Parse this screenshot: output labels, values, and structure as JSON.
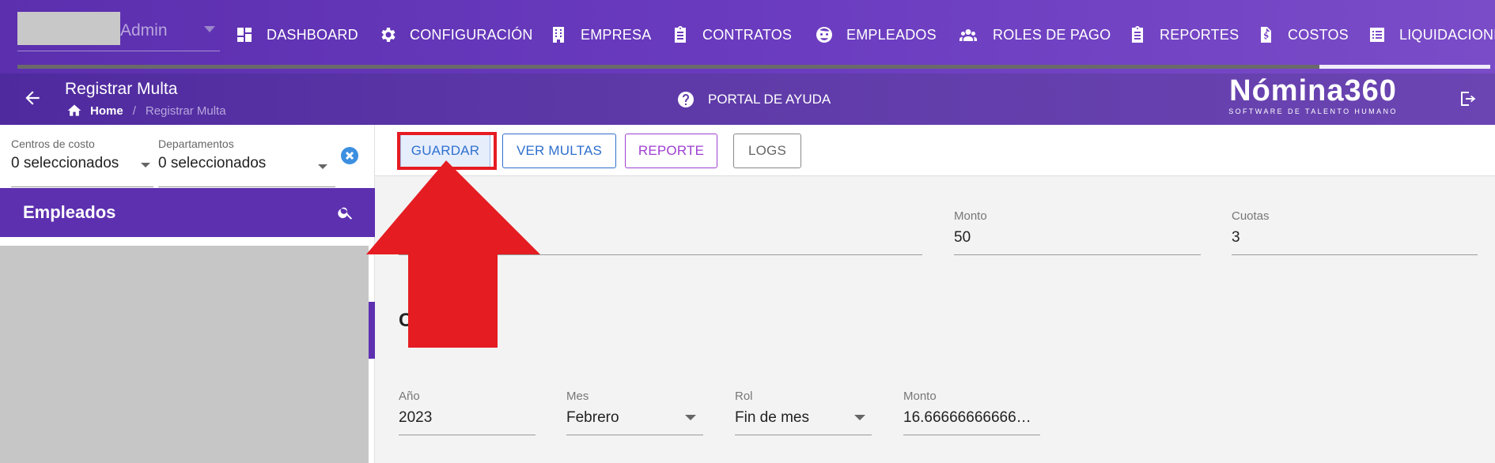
{
  "user": {
    "name": "Admin"
  },
  "nav": {
    "items": [
      {
        "label": "DASHBOARD",
        "icon": "dashboard-icon"
      },
      {
        "label": "CONFIGURACIÓN",
        "icon": "gear-icon"
      },
      {
        "label": "EMPRESA",
        "icon": "building-icon"
      },
      {
        "label": "CONTRATOS",
        "icon": "clipboard-icon"
      },
      {
        "label": "EMPLEADOS",
        "icon": "face-icon"
      },
      {
        "label": "ROLES DE PAGO",
        "icon": "people-icon"
      },
      {
        "label": "REPORTES",
        "icon": "clipboard-list-icon"
      },
      {
        "label": "COSTOS",
        "icon": "invoice-icon"
      },
      {
        "label": "LIQUIDACIONE",
        "icon": "list-icon"
      }
    ]
  },
  "header": {
    "title": "Registrar Multa",
    "breadcrumb": {
      "home": "Home",
      "separator": "/",
      "current": "Registrar Multa"
    },
    "help_label": "PORTAL DE AYUDA",
    "brand_name": "Nómina360",
    "brand_tagline": "SOFTWARE DE TALENTO HUMANO"
  },
  "filters": {
    "centros": {
      "label": "Centros de costo",
      "value": "0 seleccionados"
    },
    "departamentos": {
      "label": "Departamentos",
      "value": "0 seleccionados"
    }
  },
  "employees": {
    "title": "Empleados"
  },
  "toolbar": {
    "guardar": "GUARDAR",
    "ver_multas": "VER MULTAS",
    "reporte": "REPORTE",
    "logs": "LOGS"
  },
  "form": {
    "monto": {
      "label": "Monto",
      "value": "50"
    },
    "cuotas": {
      "label": "Cuotas",
      "value": "3"
    },
    "section_title": "C",
    "anio": {
      "label": "Año",
      "value": "2023"
    },
    "mes": {
      "label": "Mes",
      "value": "Febrero"
    },
    "rol": {
      "label": "Rol",
      "value": "Fin de mes"
    },
    "monto_cuota": {
      "label": "Monto",
      "value": "16.66666666666…"
    }
  },
  "colors": {
    "nav_bg": "#6a3bbf",
    "panel_accent": "#5d30b0",
    "annotation_red": "#e51c22",
    "primary_blue": "#2f6fcc",
    "reporte_purple": "#9e3fd2"
  }
}
